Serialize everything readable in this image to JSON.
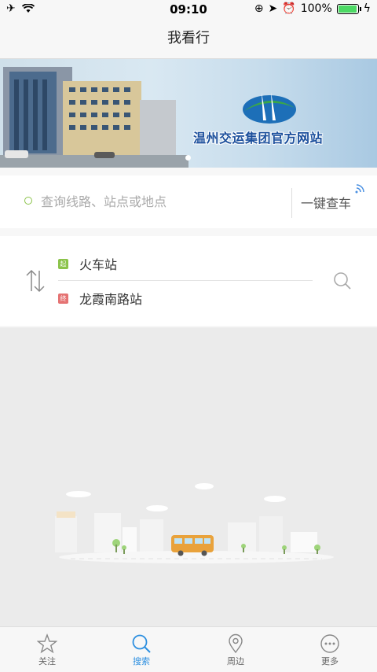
{
  "status_bar": {
    "time": "09:10",
    "battery": "100%"
  },
  "header": {
    "title": "我看行"
  },
  "banner": {
    "caption": "温州交运集团官方网站"
  },
  "search": {
    "placeholder": "查询线路、站点或地点",
    "quick_check_label": "一键查车"
  },
  "route": {
    "start": {
      "badge": "起",
      "name": "火车站"
    },
    "end": {
      "badge": "终",
      "name": "龙霞南路站"
    }
  },
  "tabs": [
    {
      "label": "关注",
      "icon": "star-icon",
      "active": false
    },
    {
      "label": "搜索",
      "icon": "search-icon",
      "active": true
    },
    {
      "label": "周边",
      "icon": "location-pin-icon",
      "active": false
    },
    {
      "label": "更多",
      "icon": "more-dots-icon",
      "active": false
    }
  ],
  "colors": {
    "accent": "#2c8fe0",
    "start_badge": "#8bc34a",
    "end_badge": "#e57373"
  }
}
